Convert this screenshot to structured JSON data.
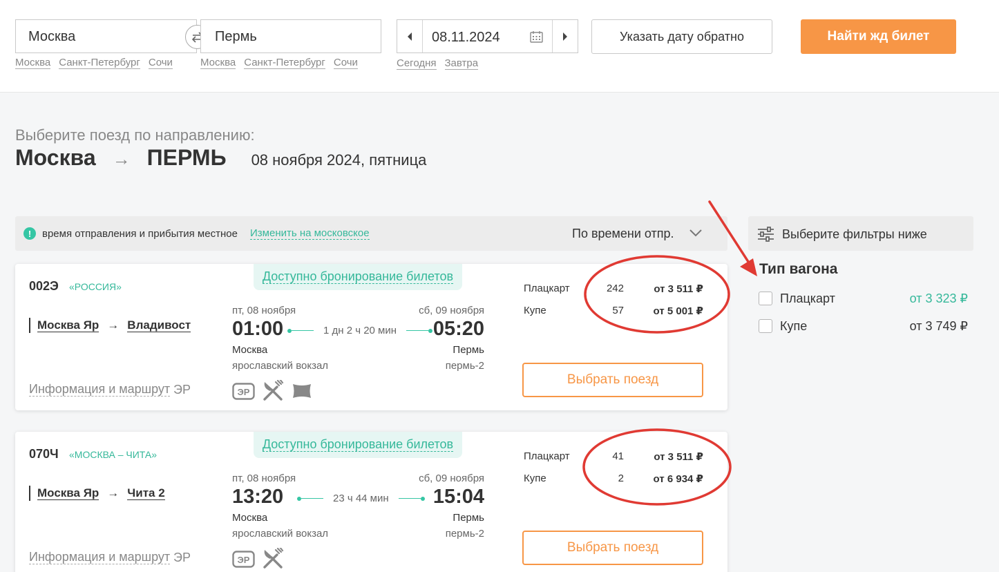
{
  "search": {
    "from": "Москва",
    "to": "Пермь",
    "from_quick": [
      "Москва",
      "Санкт-Петербург",
      "Сочи"
    ],
    "to_quick": [
      "Москва",
      "Санкт-Петербург",
      "Сочи"
    ],
    "date": "08.11.2024",
    "date_quick": [
      "Сегодня",
      "Завтра"
    ],
    "return_label": "Указать дату обратно",
    "submit_label": "Найти жд билет"
  },
  "page": {
    "subtitle": "Выберите поезд по направлению:",
    "from_city": "Москва",
    "arrow": "→",
    "to_city": "ПЕРМЬ",
    "date_long": "08 ноября 2024, пятница"
  },
  "infobar": {
    "icon_glyph": "!",
    "text": "время отправления и прибытия местное",
    "link": "Изменить на московское",
    "sort": "По времени отпр."
  },
  "filters": {
    "header": "Выберите фильтры ниже",
    "title": "Тип вагона",
    "items": [
      {
        "label": "Плацкарт",
        "price": "от 3 323 ₽",
        "price_color": "#35b89a"
      },
      {
        "label": "Купе",
        "price": "от 3 749 ₽",
        "price_color": "#333333"
      }
    ]
  },
  "trains": [
    {
      "booking": "Доступно бронирование билетов",
      "number": "002Э",
      "brand": "«РОССИЯ»",
      "route_from": "Москва Яр",
      "route_arrow": "→",
      "route_to": "Владивост",
      "info_link": "Информация и маршрут",
      "er": "ЭР",
      "dep_date": "пт, 08 ноября",
      "dep_time": "01:00",
      "duration": "1 дн 2 ч 20 мин",
      "arr_date": "сб, 09 ноября",
      "arr_time": "05:20",
      "dep_station": "Москва",
      "dep_station_sub": "ярославский вокзал",
      "arr_station": "Пермь",
      "arr_station_sub": "пермь-2",
      "classes": [
        {
          "name": "Плацкарт",
          "seats": "242",
          "price": "от 3 511 ₽"
        },
        {
          "name": "Купе",
          "seats": "57",
          "price": "от 5 001 ₽"
        }
      ],
      "select_label": "Выбрать поезд",
      "amenity_icons": [
        "er-icon",
        "restaurant-icon",
        "pillow-icon"
      ]
    },
    {
      "booking": "Доступно бронирование билетов",
      "number": "070Ч",
      "brand": "«МОСКВА – ЧИТА»",
      "route_from": "Москва Яр",
      "route_arrow": "→",
      "route_to": "Чита 2",
      "info_link": "Информация и маршрут",
      "er": "ЭР",
      "dep_date": "пт, 08 ноября",
      "dep_time": "13:20",
      "duration": "23 ч 44 мин",
      "arr_date": "сб, 09 ноября",
      "arr_time": "15:04",
      "dep_station": "Москва",
      "dep_station_sub": "ярославский вокзал",
      "arr_station": "Пермь",
      "arr_station_sub": "пермь-2",
      "classes": [
        {
          "name": "Плацкарт",
          "seats": "41",
          "price": "от 3 511 ₽"
        },
        {
          "name": "Купе",
          "seats": "2",
          "price": "от 6 934 ₽"
        }
      ],
      "select_label": "Выбрать поезд",
      "amenity_icons": [
        "er-icon",
        "restaurant-icon"
      ]
    }
  ],
  "colors": {
    "accent_orange": "#f79646",
    "accent_green": "#35b89a",
    "annotation_red": "#e03a33"
  }
}
